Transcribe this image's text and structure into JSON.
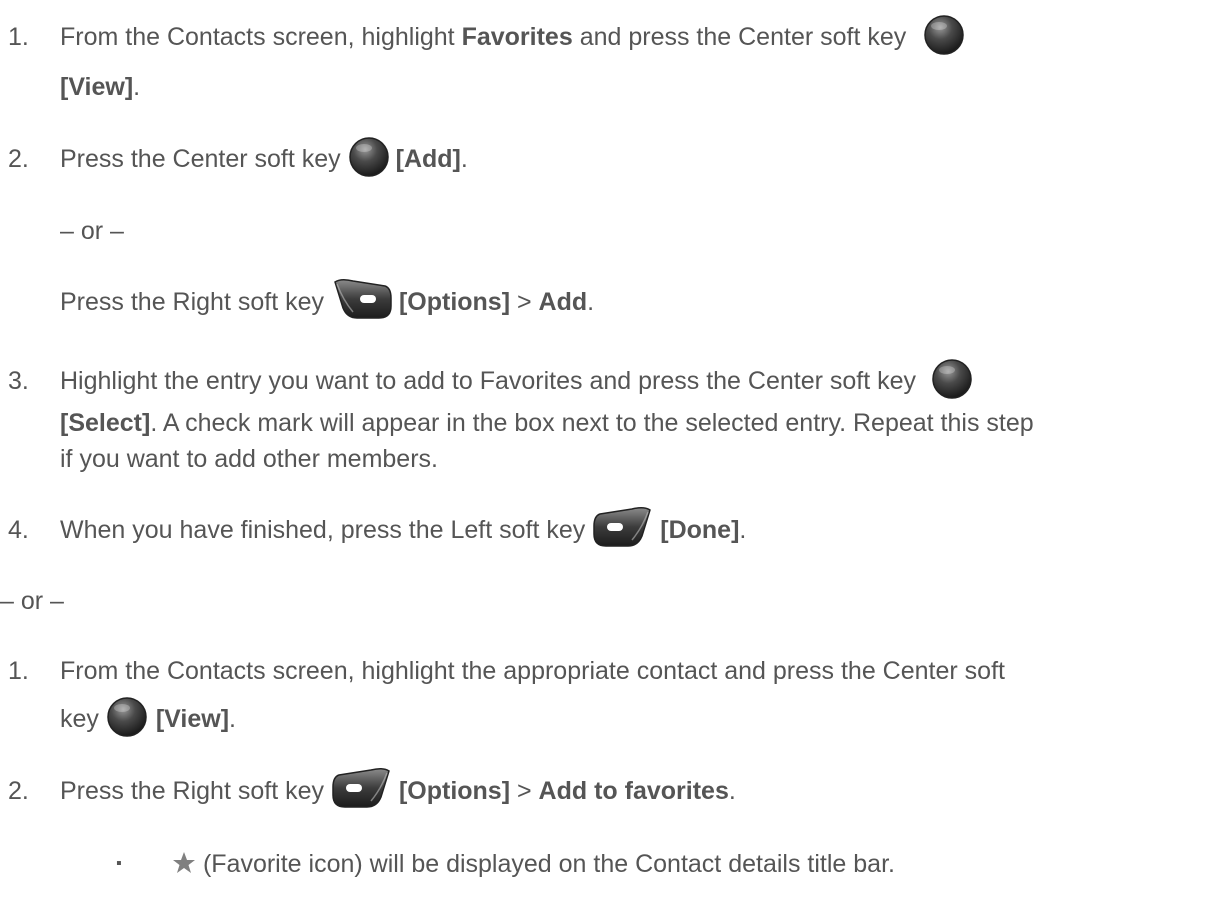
{
  "first_method": {
    "steps": [
      {
        "number": "1.",
        "line1_text": "From the Contacts screen, highlight ",
        "line1_bold": "Favorites",
        "line1_text2": " and press the Center soft key",
        "line2_bold": "[View]",
        "line2_text": ".",
        "icon": "center-soft-key-icon"
      },
      {
        "number": "2.",
        "text": "Press the Center soft key ",
        "bold": "[Add]",
        "after": ".",
        "icon": "center-soft-key-icon",
        "or": "– or –",
        "alt_text": "Press the Right soft key ",
        "alt_bold1": "[Options]",
        "alt_sep": " > ",
        "alt_bold2": "Add",
        "alt_after": ".",
        "alt_icon": "right-soft-key-icon"
      },
      {
        "number": "3.",
        "line1_text": "Highlight the entry you want to add to Favorites and press the Center soft key",
        "line2_bold": "[Select]",
        "line2_text": ". A check mark will appear in the box next to the selected entry. Repeat this step",
        "line3_text": "if you want to add other members.",
        "icon": "center-soft-key-icon"
      },
      {
        "number": "4.",
        "text": "When you have finished, press the Left soft key ",
        "bold": "[Done]",
        "after": ".",
        "icon": "left-soft-key-icon"
      }
    ]
  },
  "separator": "– or –",
  "second_method": {
    "steps": [
      {
        "number": "1.",
        "line1_text": "From the Contacts screen, highlight the appropriate contact and press the Center soft",
        "line2_text": "key ",
        "line2_bold": "[View]",
        "line2_after": ".",
        "icon": "center-soft-key-icon"
      },
      {
        "number": "2.",
        "text": "Press the Right soft key ",
        "bold1": "[Options]",
        "sep": " > ",
        "bold2": "Add to favorites",
        "after": ".",
        "icon": "left-soft-key-icon"
      }
    ],
    "bullet": {
      "marker": "▪",
      "text": " (Favorite icon) will be displayed on the Contact details title bar.",
      "icon": "favorite-star-icon",
      "star_color": "#808080"
    }
  },
  "colors": {
    "text": "#555555",
    "key_dark": "#2a2a2a",
    "key_light": "#8a8a8a"
  }
}
